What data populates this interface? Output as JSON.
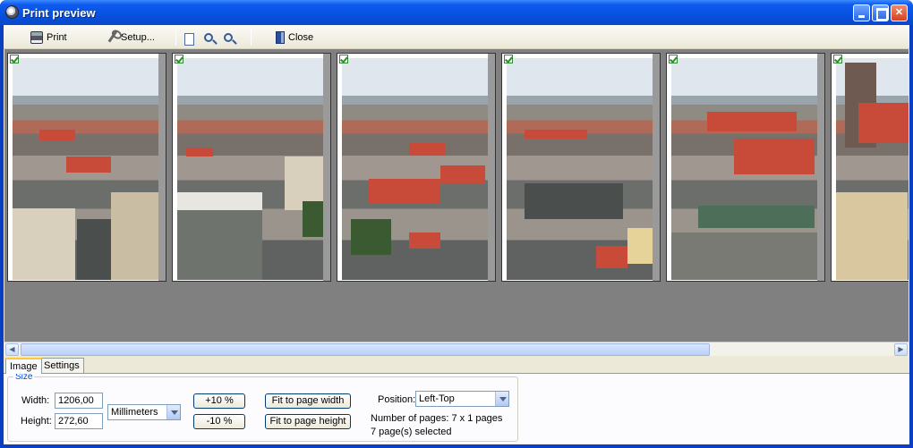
{
  "window": {
    "title": "Print preview"
  },
  "toolbar": {
    "print_label": "Print",
    "setup_label": "Setup...",
    "close_label": "Close",
    "icons": [
      "printer-icon",
      "wrench-icon",
      "page-preview-icon",
      "zoom-in-icon",
      "zoom-out-icon",
      "close-door-icon"
    ]
  },
  "preview": {
    "pages": [
      {
        "checked": true
      },
      {
        "checked": true
      },
      {
        "checked": true
      },
      {
        "checked": true
      },
      {
        "checked": true
      },
      {
        "checked": true
      }
    ]
  },
  "tabs": [
    {
      "label": "Image",
      "active": true
    },
    {
      "label": "Settings",
      "active": false
    }
  ],
  "size_group": {
    "title": "Size",
    "width_label": "Width:",
    "width_value": "1206,00",
    "height_label": "Height:",
    "height_value": "272,60",
    "unit": "Millimeters",
    "plus_label": "+10 %",
    "minus_label": "-10 %",
    "fit_width_label": "Fit to page width",
    "fit_height_label": "Fit to page height",
    "position_label": "Position:",
    "position_value": "Left-Top",
    "pages_info": "Number of pages: 7 x 1 pages",
    "selected_info": "7 page(s) selected"
  },
  "colors": {
    "titlebar": "#0651e0",
    "preview_bg": "#808080",
    "group_title": "#0046d5",
    "roof": "#c84a38"
  }
}
